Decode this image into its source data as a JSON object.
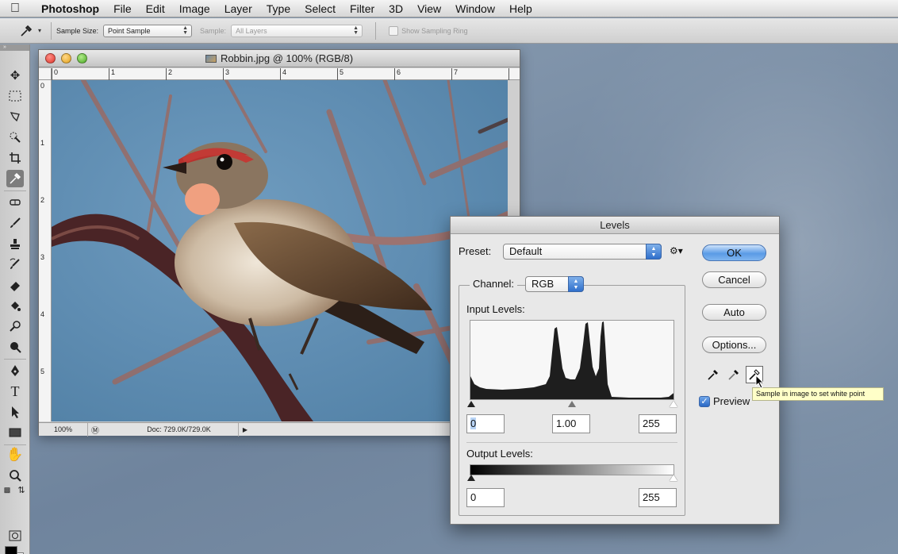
{
  "menubar": {
    "app": "Photoshop",
    "items": [
      "File",
      "Edit",
      "Image",
      "Layer",
      "Type",
      "Select",
      "Filter",
      "3D",
      "View",
      "Window",
      "Help"
    ]
  },
  "options": {
    "sample_size_label": "Sample Size:",
    "sample_size_value": "Point Sample",
    "sample_label": "Sample:",
    "sample_value": "All Layers",
    "sampling_ring_label": "Show Sampling Ring"
  },
  "document": {
    "title": "Robbin.jpg @ 100% (RGB/8)",
    "zoom": "100%",
    "doc_info": "Doc: 729.0K/729.0K",
    "ruler_top": [
      "0",
      "1",
      "2",
      "3",
      "4",
      "5",
      "6",
      "7"
    ],
    "ruler_left": [
      "0",
      "1",
      "2",
      "3",
      "4",
      "5"
    ]
  },
  "levels": {
    "title": "Levels",
    "preset_label": "Preset:",
    "preset_value": "Default",
    "channel_label": "Channel:",
    "channel_value": "RGB",
    "input_levels_label": "Input Levels:",
    "input_black": "0",
    "input_gamma": "1.00",
    "input_white": "255",
    "output_levels_label": "Output Levels:",
    "output_black": "0",
    "output_white": "255",
    "buttons": {
      "ok": "OK",
      "cancel": "Cancel",
      "auto": "Auto",
      "options": "Options..."
    },
    "preview_label": "Preview",
    "tooltip": "Sample in image to set white point"
  },
  "colors": {
    "foreground": "#000000",
    "background": "#ffffff",
    "accent": "#2f6fcb"
  }
}
